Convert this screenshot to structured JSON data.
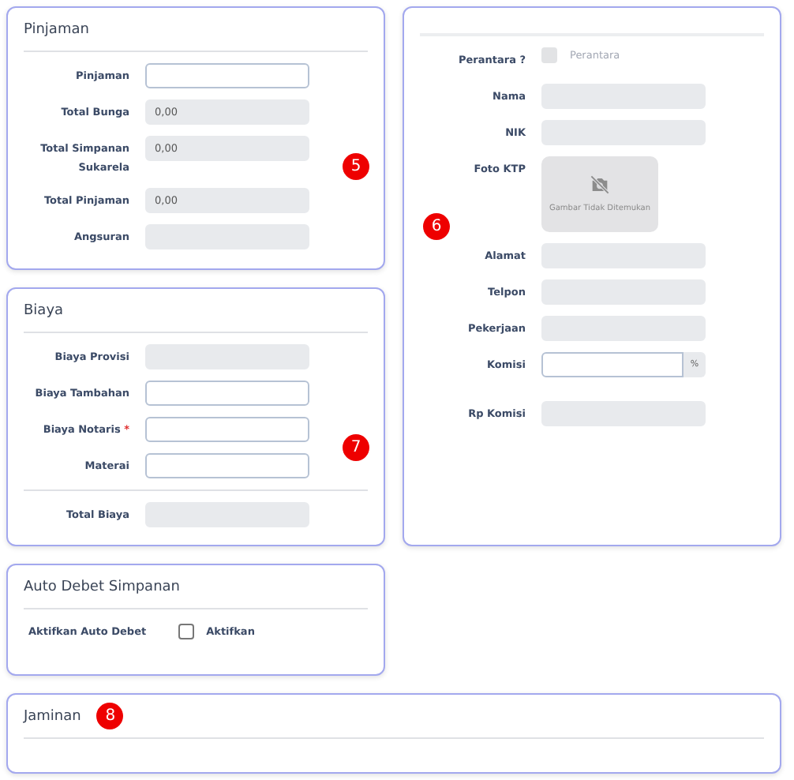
{
  "left": [
    {
      "title": "Pinjaman",
      "badge": {
        "text": "5"
      },
      "fields": [
        {
          "kind": "input",
          "label": "Pinjaman"
        },
        {
          "kind": "readonly",
          "label": "Total Bunga",
          "value": "0,00"
        },
        {
          "kind": "readonly",
          "label": "Total Simpanan Sukarela",
          "value": "0,00"
        },
        {
          "kind": "readonly",
          "label": "Total Pinjaman",
          "value": "0,00"
        },
        {
          "kind": "readonly",
          "label": "Angsuran"
        }
      ]
    },
    {
      "title": "Biaya",
      "badge": {
        "text": "7"
      },
      "fields": [
        {
          "kind": "readonly",
          "label": "Biaya Provisi"
        },
        {
          "kind": "input",
          "label": "Biaya Tambahan"
        },
        {
          "kind": "input",
          "label": "Biaya Notaris",
          "required": "*"
        },
        {
          "kind": "input",
          "label": "Materai"
        },
        {
          "kind": "divider"
        },
        {
          "kind": "readonly",
          "label": "Total Biaya"
        }
      ]
    },
    {
      "title": "Auto Debet Simpanan",
      "fields": [
        {
          "kind": "checkbox",
          "label": "Aktifkan Auto Debet",
          "option": "Aktifkan",
          "checked": false,
          "disabled": false
        }
      ]
    }
  ],
  "right": {
    "badge": {
      "text": "6"
    },
    "fields": [
      {
        "kind": "checkbox",
        "label": "Perantara ?",
        "option": "Perantara",
        "checked": false,
        "disabled": true
      },
      {
        "kind": "readonly",
        "label": "Nama"
      },
      {
        "kind": "readonly",
        "label": "NIK"
      },
      {
        "kind": "photo",
        "label": "Foto KTP",
        "caption": "Gambar Tidak Ditemukan"
      },
      {
        "kind": "readonly",
        "label": "Alamat"
      },
      {
        "kind": "readonly",
        "label": "Telpon"
      },
      {
        "kind": "readonly",
        "label": "Pekerjaan"
      },
      {
        "kind": "addon",
        "label": "Komisi",
        "addon": "%"
      },
      {
        "kind": "readonly",
        "label": "Rp Komisi"
      }
    ]
  },
  "bottom": {
    "title": "Jaminan",
    "badge": {
      "text": "8"
    }
  }
}
